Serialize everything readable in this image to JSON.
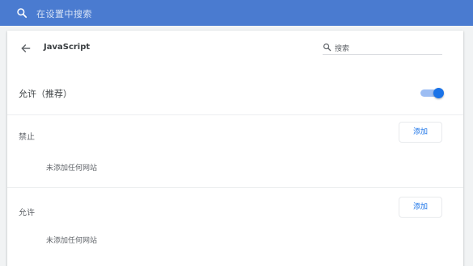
{
  "search": {
    "placeholder": "在设置中搜索"
  },
  "page": {
    "title": "JavaScript",
    "search_placeholder": "搜索"
  },
  "allow_recommended": {
    "label": "允许（推荐）",
    "enabled": true
  },
  "block": {
    "label": "禁止",
    "add_label": "添加",
    "empty": "未添加任何网站"
  },
  "allow": {
    "label": "允许",
    "add_label": "添加",
    "empty": "未添加任何网站"
  },
  "colors": {
    "header": "#4a7bd0",
    "accent": "#1a73e8"
  }
}
